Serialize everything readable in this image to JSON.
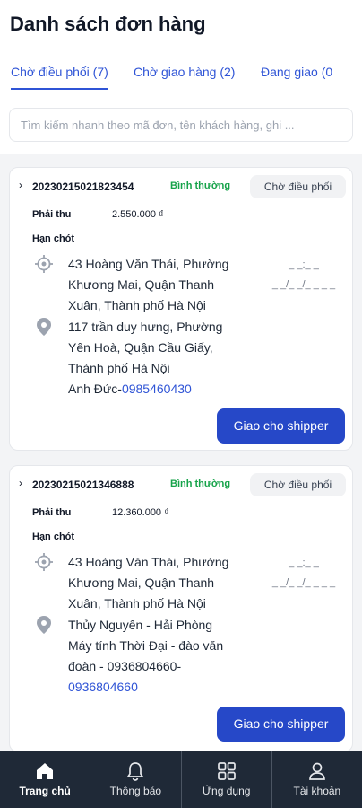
{
  "header": {
    "title": "Danh sách đơn hàng"
  },
  "tabs": [
    {
      "label": "Chờ điều phối (7)"
    },
    {
      "label": "Chờ giao hàng (2)"
    },
    {
      "label": "Đang giao (0"
    }
  ],
  "search": {
    "placeholder": "Tìm kiếm nhanh theo mã đơn, tên khách hàng, ghi ..."
  },
  "orders": [
    {
      "code": "20230215021823454",
      "priority": "Bình thường",
      "status": "Chờ điều phối",
      "amount_label": "Phải thu",
      "amount": "2.550.000 ₫",
      "deadline_label": "Hạn chót",
      "pickup_lines": [
        "43 Hoàng Văn Thái, Phường",
        "Khương Mai, Quận Thanh",
        "Xuân, Thành phố Hà Nội"
      ],
      "dropoff_lines": [
        "117 trần duy hưng, Phường",
        "Yên Hoà, Quận Cầu Giấy,",
        "Thành phố Hà Nội"
      ],
      "contact_name": "Anh Đức-",
      "contact_phone": "0985460430",
      "time_line1": "_ _:_ _",
      "time_line2": "_ _/_ _/_ _ _ _",
      "action": "Giao cho shipper"
    },
    {
      "code": "20230215021346888",
      "priority": "Bình thường",
      "status": "Chờ điều phối",
      "amount_label": "Phải thu",
      "amount": "12.360.000 ₫",
      "deadline_label": "Hạn chót",
      "pickup_lines": [
        "43 Hoàng Văn Thái, Phường",
        "Khương Mai, Quận Thanh",
        "Xuân, Thành phố Hà Nội"
      ],
      "dropoff_lines": [
        "Thủy Nguyên - Hải Phòng",
        "Máy tính Thời Đại - đào văn",
        "đoàn - 0936804660-"
      ],
      "contact_phone": "0936804660",
      "time_line1": "_ _:_ _",
      "time_line2": "_ _/_ _/_ _ _ _",
      "action": "Giao cho shipper"
    }
  ],
  "nav": [
    {
      "label": "Trang chủ",
      "icon": "home-icon"
    },
    {
      "label": "Thông báo",
      "icon": "bell-icon"
    },
    {
      "label": "Ứng dụng",
      "icon": "apps-grid-icon"
    },
    {
      "label": "Tài khoản",
      "icon": "user-icon"
    }
  ],
  "colors": {
    "accent": "#2f54d6",
    "button": "#2648c8",
    "priority": "#16a34a",
    "nav_bg": "#1f2937"
  }
}
